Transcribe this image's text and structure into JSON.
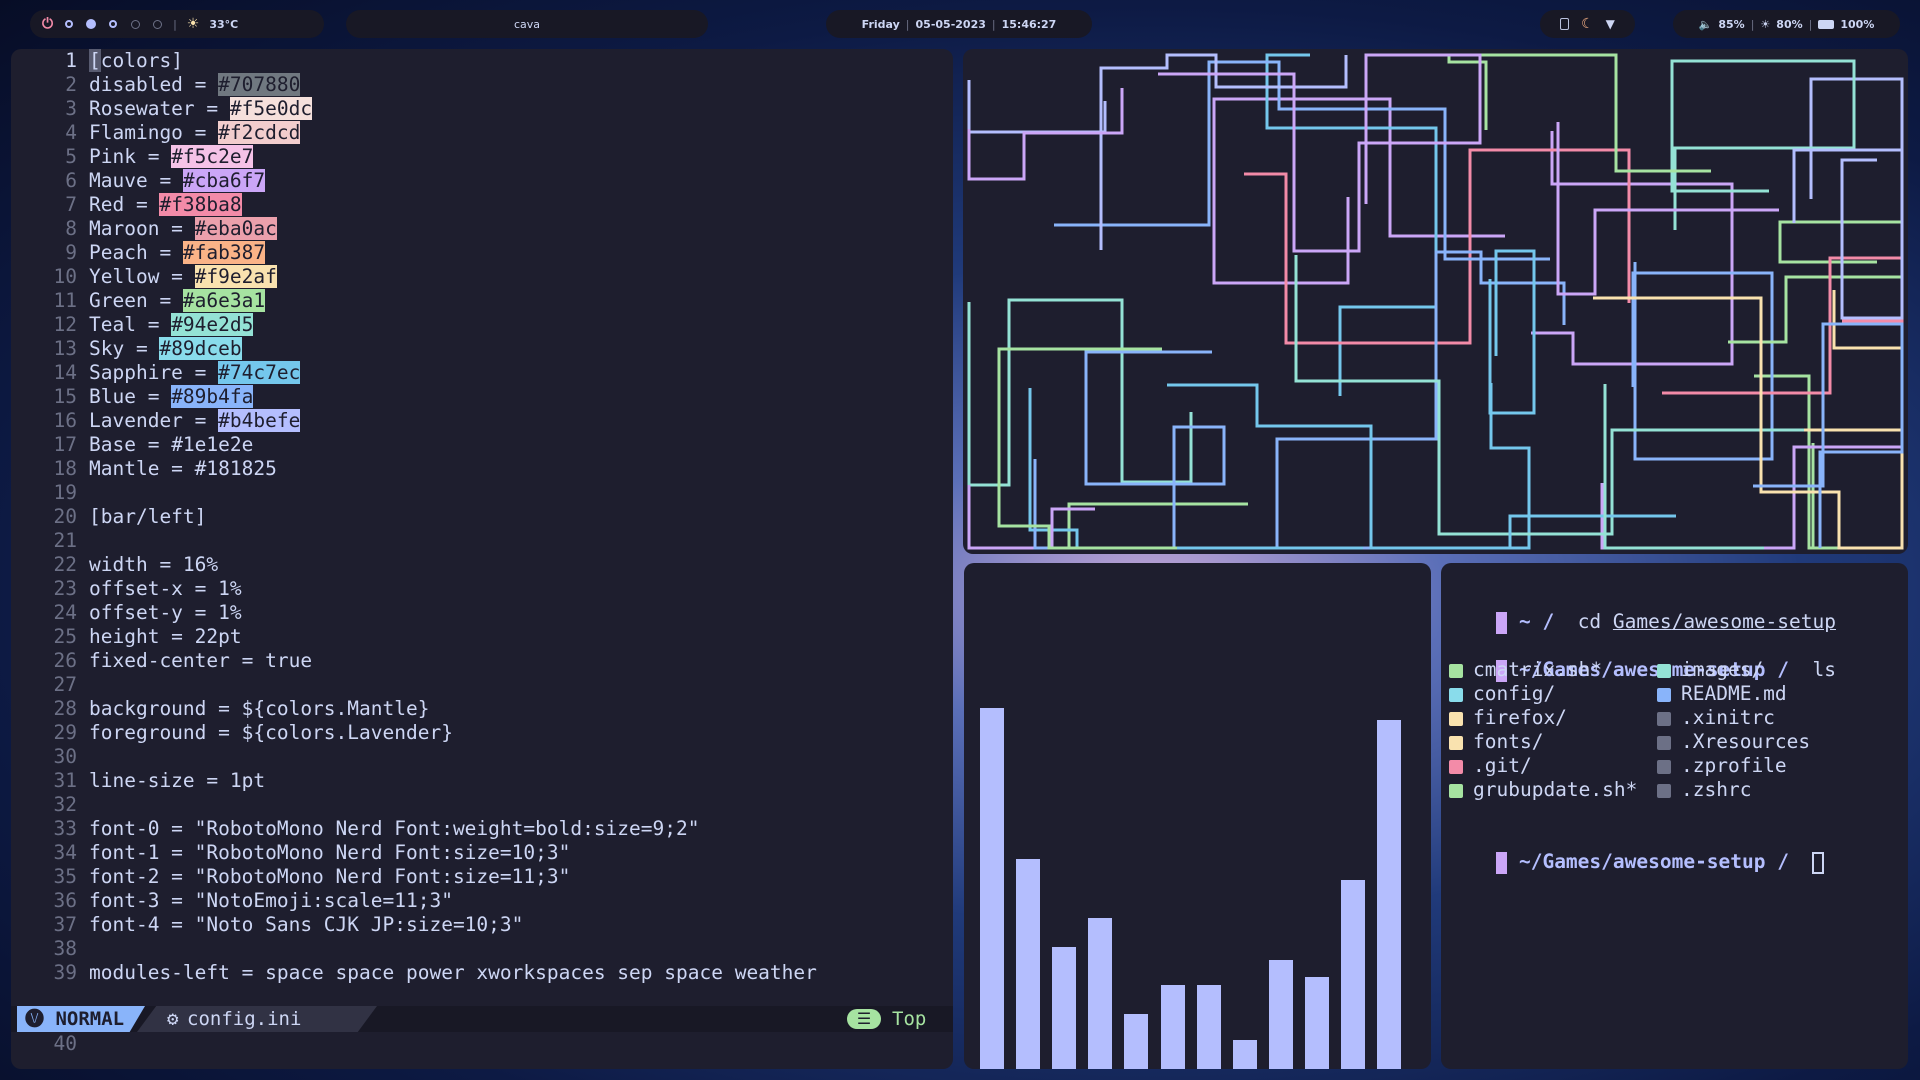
{
  "topbar": {
    "weather": "33°C",
    "title": "cava",
    "day": "Friday",
    "date": "05-05-2023",
    "time": "15:46:27",
    "volume": "85%",
    "brightness": "80%",
    "battery": "100%"
  },
  "editor": {
    "lines": [
      {
        "n": "1",
        "text": "[colors]",
        "cursor": true
      },
      {
        "n": "2",
        "key": "disabled = ",
        "hex": "#707880",
        "color": "#707880"
      },
      {
        "n": "3",
        "key": "Rosewater = ",
        "hex": "#f5e0dc",
        "color": "#f5e0dc"
      },
      {
        "n": "4",
        "key": "Flamingo = ",
        "hex": "#f2cdcd",
        "color": "#f2cdcd"
      },
      {
        "n": "5",
        "key": "Pink = ",
        "hex": "#f5c2e7",
        "color": "#f5c2e7"
      },
      {
        "n": "6",
        "key": "Mauve = ",
        "hex": "#cba6f7",
        "color": "#cba6f7"
      },
      {
        "n": "7",
        "key": "Red = ",
        "hex": "#f38ba8",
        "color": "#f38ba8"
      },
      {
        "n": "8",
        "key": "Maroon = ",
        "hex": "#eba0ac",
        "color": "#eba0ac"
      },
      {
        "n": "9",
        "key": "Peach = ",
        "hex": "#fab387",
        "color": "#fab387"
      },
      {
        "n": "10",
        "key": "Yellow = ",
        "hex": "#f9e2af",
        "color": "#f9e2af"
      },
      {
        "n": "11",
        "key": "Green = ",
        "hex": "#a6e3a1",
        "color": "#a6e3a1"
      },
      {
        "n": "12",
        "key": "Teal = ",
        "hex": "#94e2d5",
        "color": "#94e2d5"
      },
      {
        "n": "13",
        "key": "Sky = ",
        "hex": "#89dceb",
        "color": "#89dceb"
      },
      {
        "n": "14",
        "key": "Sapphire = ",
        "hex": "#74c7ec",
        "color": "#74c7ec"
      },
      {
        "n": "15",
        "key": "Blue = ",
        "hex": "#89b4fa",
        "color": "#89b4fa"
      },
      {
        "n": "16",
        "key": "Lavender = ",
        "hex": "#b4befe",
        "color": "#b4befe"
      },
      {
        "n": "17",
        "key": "Base = ",
        "plainhex": "#1e1e2e"
      },
      {
        "n": "18",
        "key": "Mantle = ",
        "plainhex": "#181825"
      },
      {
        "n": "19",
        "text": ""
      },
      {
        "n": "20",
        "text": "[bar/left]"
      },
      {
        "n": "21",
        "text": ""
      },
      {
        "n": "22",
        "text": "width = 16%"
      },
      {
        "n": "23",
        "text": "offset-x = 1%"
      },
      {
        "n": "24",
        "text": "offset-y = 1%"
      },
      {
        "n": "25",
        "text": "height = 22pt"
      },
      {
        "n": "26",
        "text": "fixed-center = true"
      },
      {
        "n": "27",
        "text": ""
      },
      {
        "n": "28",
        "text": "background = ${colors.Mantle}"
      },
      {
        "n": "29",
        "text": "foreground = ${colors.Lavender}"
      },
      {
        "n": "30",
        "text": ""
      },
      {
        "n": "31",
        "text": "line-size = 1pt"
      },
      {
        "n": "32",
        "text": ""
      },
      {
        "n": "33",
        "text": "font-0 = \"RobotoMono Nerd Font:weight=bold:size=9;2\""
      },
      {
        "n": "34",
        "text": "font-1 = \"RobotoMono Nerd Font:size=10;3\""
      },
      {
        "n": "35",
        "text": "font-2 = \"RobotoMono Nerd Font:size=11;3\""
      },
      {
        "n": "36",
        "text": "font-3 = \"NotoEmoji:scale=11;3\""
      },
      {
        "n": "37",
        "text": "font-4 = \"Noto Sans CJK JP:size=10;3\""
      },
      {
        "n": "38",
        "text": ""
      },
      {
        "n": "39",
        "text": "modules-left = space space power xworkspaces sep space weather"
      }
    ],
    "tail_line": "40",
    "mode": "NORMAL",
    "filename": "config.ini",
    "position": "Top"
  },
  "cava": {
    "bar_color": "#b4befe",
    "levels": [
      0.86,
      0.5,
      0.29,
      0.36,
      0.13,
      0.2,
      0.2,
      0.07,
      0.26,
      0.22,
      0.45,
      0.83
    ]
  },
  "terminal": {
    "cmd1_dir": "~ /",
    "cmd1_cmd": "cd",
    "cmd1_arg1": "Games",
    "cmd1_arg2": "/awesome-setup",
    "cmd2_dir": "~/Games/awesome-setup /",
    "cmd2_cmd": "ls",
    "files_left": [
      {
        "name": "cmatrix.sh*",
        "color": "#a6e3a1"
      },
      {
        "name": "config/",
        "color": "#89dceb"
      },
      {
        "name": "firefox/",
        "color": "#f9e2af"
      },
      {
        "name": "fonts/",
        "color": "#f9e2af"
      },
      {
        "name": ".git/",
        "color": "#f38ba8"
      },
      {
        "name": "grubupdate.sh*",
        "color": "#a6e3a1"
      }
    ],
    "files_right": [
      {
        "name": "images/",
        "color": "#94e2d5"
      },
      {
        "name": "README.md",
        "color": "#89b4fa"
      },
      {
        "name": ".xinitrc",
        "color": "#6c7086"
      },
      {
        "name": ".Xresources",
        "color": "#6c7086"
      },
      {
        "name": ".zprofile",
        "color": "#6c7086"
      },
      {
        "name": ".zshrc",
        "color": "#6c7086"
      }
    ],
    "cmd3_dir": "~/Games/awesome-setup /"
  },
  "colors": {
    "base": "#1e1e2e",
    "mantle": "#181825",
    "lavender": "#b4befe",
    "mauve": "#cba6f7"
  }
}
